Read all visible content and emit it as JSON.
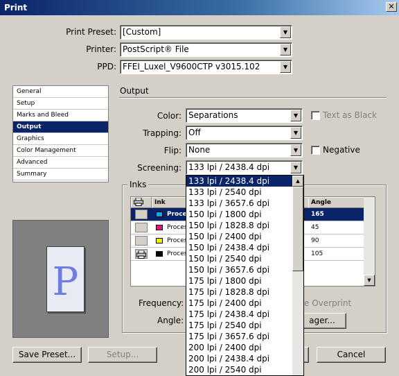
{
  "window": {
    "title": "Print",
    "close_glyph": "✕"
  },
  "top": {
    "preset_label": "Print Preset:",
    "preset_value": "[Custom]",
    "printer_label": "Printer:",
    "printer_value": "PostScript® File",
    "ppd_label": "PPD:",
    "ppd_value": "FFEI_Luxel_V9600CTP v3015.102"
  },
  "sidebar": {
    "items": [
      {
        "label": "General"
      },
      {
        "label": "Setup"
      },
      {
        "label": "Marks and Bleed"
      },
      {
        "label": "Output"
      },
      {
        "label": "Graphics"
      },
      {
        "label": "Color Management"
      },
      {
        "label": "Advanced"
      },
      {
        "label": "Summary"
      }
    ],
    "selected_index": 3
  },
  "preview": {
    "letter": "P"
  },
  "output": {
    "section_title": "Output",
    "color_label": "Color:",
    "color_value": "Separations",
    "text_as_black": "Text as Black",
    "trapping_label": "Trapping:",
    "trapping_value": "Off",
    "flip_label": "Flip:",
    "flip_value": "None",
    "negative": "Negative",
    "screening_label": "Screening:",
    "screening_value": "133 lpi / 2438.4 dpi"
  },
  "inks": {
    "group_title": "Inks",
    "col_ink": "Ink",
    "col_angle": "Angle",
    "rows": [
      {
        "name": "Proce",
        "angle": "165",
        "color": "#1ba3dc"
      },
      {
        "name": "Proces",
        "angle": "45",
        "color": "#e0147c"
      },
      {
        "name": "Proces",
        "angle": "90",
        "color": "#f0f000"
      },
      {
        "name": "Proces",
        "angle": "105",
        "color": "#000000"
      }
    ],
    "frequency_label": "Frequency:",
    "angle_label": "Angle:",
    "simulate_overprint": "e Overprint",
    "ink_manager": "ager..."
  },
  "screening_options": [
    "133 lpi / 2438.4 dpi",
    "133 lpi / 2540 dpi",
    "133 lpi / 3657.6 dpi",
    "150 lpi / 1800 dpi",
    "150 lpi / 1828.8 dpi",
    "150 lpi / 2400 dpi",
    "150 lpi / 2438.4 dpi",
    "150 lpi / 2540 dpi",
    "150 lpi / 3657.6 dpi",
    "175 lpi / 1800 dpi",
    "175 lpi / 1828.8 dpi",
    "175 lpi / 2400 dpi",
    "175 lpi / 2438.4 dpi",
    "175 lpi / 2540 dpi",
    "175 lpi / 3657.6 dpi",
    "200 lpi / 2400 dpi",
    "200 lpi / 2438.4 dpi",
    "200 lpi / 2540 dpi"
  ],
  "bottom": {
    "save_preset": "Save Preset...",
    "setup": "Setup...",
    "cancel": "Cancel"
  },
  "colors": {
    "selection": "#0a246a",
    "face": "#d4d0c8"
  }
}
